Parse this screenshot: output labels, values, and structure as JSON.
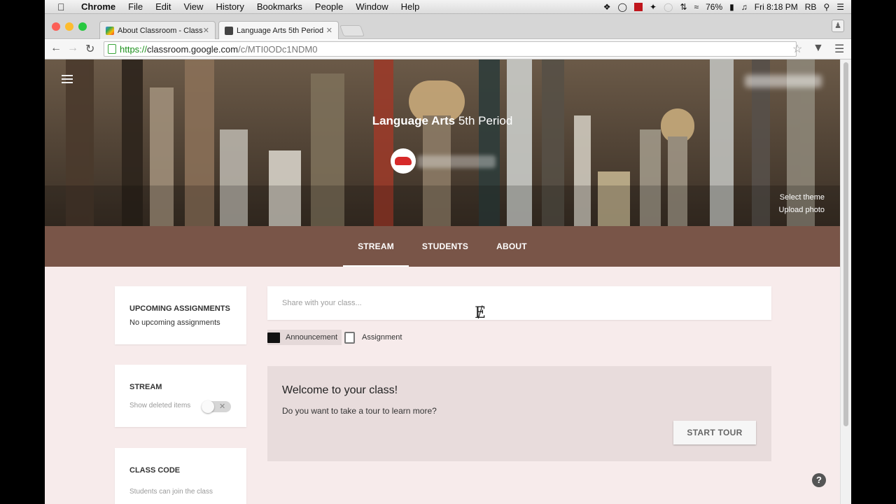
{
  "menubar": {
    "app": "Chrome",
    "items": [
      "File",
      "Edit",
      "View",
      "History",
      "Bookmarks",
      "People",
      "Window",
      "Help"
    ],
    "battery": "76%",
    "clock": "Fri 8:18 PM",
    "user": "RB"
  },
  "tabs": [
    {
      "label": "About Classroom - Class"
    },
    {
      "label": "Language Arts 5th Period"
    }
  ],
  "address": {
    "scheme": "https://",
    "host": "classroom.google.com",
    "path": "/c/MTI0ODc1NDM0"
  },
  "banner": {
    "class_name": "Language Arts",
    "section": "5th Period",
    "select_theme": "Select theme",
    "upload_photo": "Upload photo"
  },
  "nav": {
    "stream": "STREAM",
    "students": "STUDENTS",
    "about": "ABOUT"
  },
  "upcoming": {
    "title": "UPCOMING ASSIGNMENTS",
    "text": "No upcoming assignments"
  },
  "stream_settings": {
    "title": "STREAM",
    "toggle_label": "Show deleted items"
  },
  "class_code": {
    "title": "CLASS CODE",
    "text": "Students can join the class"
  },
  "share": {
    "placeholder": "Share with your class...",
    "announcement": "Announcement",
    "assignment": "Assignment"
  },
  "welcome": {
    "title": "Welcome to your class!",
    "subtitle": "Do you want to take a tour to learn more?",
    "button": "START TOUR"
  },
  "colors": {
    "theme": "#795548",
    "page_bg": "#f7ebeb"
  }
}
